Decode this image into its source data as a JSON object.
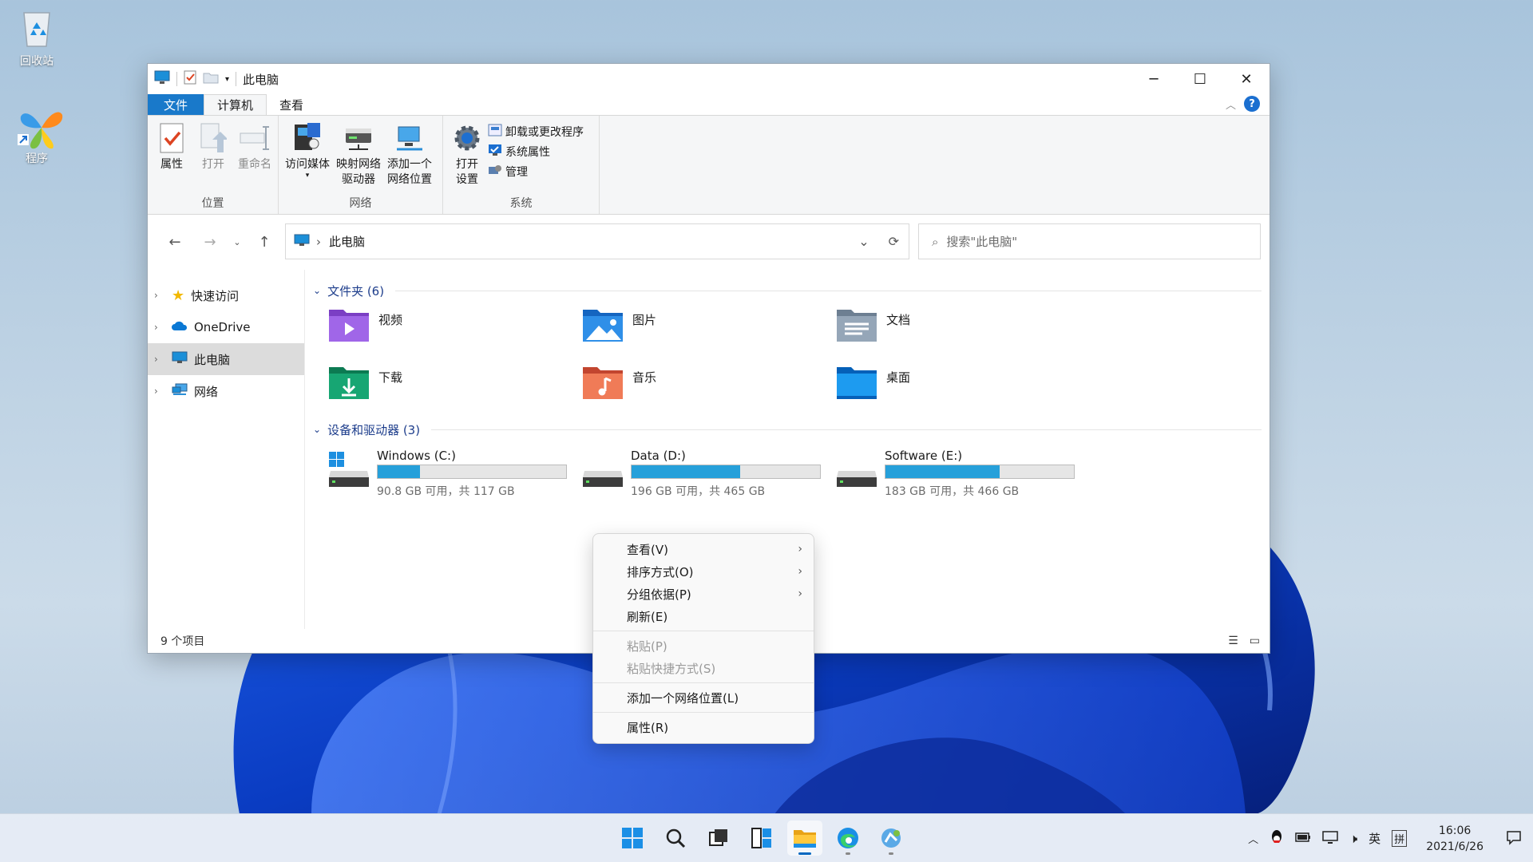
{
  "desktop": {
    "icons": [
      {
        "name": "recycle-bin",
        "label": "回收站"
      },
      {
        "name": "program",
        "label": "程序"
      }
    ]
  },
  "window": {
    "title": "此电脑",
    "tabs": {
      "file": "文件",
      "computer": "计算机",
      "view": "查看"
    },
    "ribbon": {
      "location": {
        "label": "位置",
        "properties": "属性",
        "open": "打开",
        "rename": "重命名"
      },
      "network": {
        "label": "网络",
        "media_line1": "访问媒体",
        "map_line1": "映射网络",
        "map_line2": "驱动器",
        "add_line1": "添加一个",
        "add_line2": "网络位置"
      },
      "system": {
        "label": "系统",
        "settings_line1": "打开",
        "settings_line2": "设置",
        "uninstall": "卸载或更改程序",
        "sysprops": "系统属性",
        "manage": "管理"
      }
    },
    "address": {
      "path": "此电脑"
    },
    "search": {
      "placeholder": "搜索\"此电脑\""
    },
    "sidebar": [
      {
        "label": "快速访问"
      },
      {
        "label": "OneDrive"
      },
      {
        "label": "此电脑"
      },
      {
        "label": "网络"
      }
    ],
    "folders_header": "文件夹 (6)",
    "folders": [
      {
        "label": "视频"
      },
      {
        "label": "图片"
      },
      {
        "label": "文档"
      },
      {
        "label": "下载"
      },
      {
        "label": "音乐"
      },
      {
        "label": "桌面"
      }
    ],
    "drives_header": "设备和驱动器 (3)",
    "drives": [
      {
        "label": "Windows (C:)",
        "free": "90.8 GB 可用，共 117 GB",
        "used_fraction": 0.224
      },
      {
        "label": "Data (D:)",
        "free": "196 GB 可用，共 465 GB",
        "used_fraction": 0.578
      },
      {
        "label": "Software (E:)",
        "free": "183 GB 可用，共 466 GB",
        "used_fraction": 0.607
      }
    ],
    "status": "9 个项目"
  },
  "context_menu": {
    "view": "查看(V)",
    "sort": "排序方式(O)",
    "group": "分组依据(P)",
    "refresh": "刷新(E)",
    "paste": "粘贴(P)",
    "paste_shortcut": "粘贴快捷方式(S)",
    "add_network": "添加一个网络位置(L)",
    "properties": "属性(R)"
  },
  "taskbar": {
    "ime_lang": "英",
    "ime_mode": "拼",
    "time": "16:06",
    "date": "2021/6/26"
  },
  "colors": {
    "accent": "#1979ca",
    "drive_fill": "#26a0da"
  }
}
